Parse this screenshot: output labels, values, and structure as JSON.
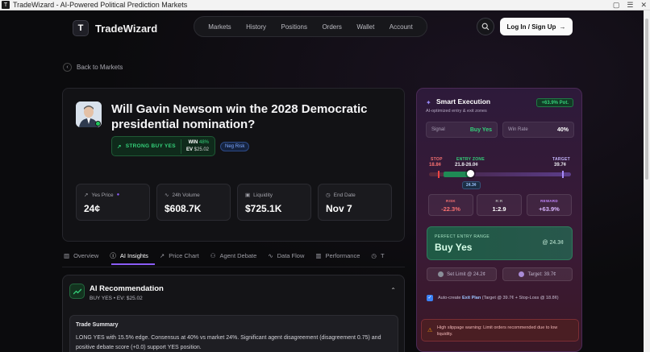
{
  "browser": {
    "title": "TradeWizard - AI-Powered Political Prediction Markets"
  },
  "brand": {
    "logo_letter": "T",
    "name": "TradeWizard"
  },
  "nav": {
    "items": [
      "Markets",
      "History",
      "Positions",
      "Orders",
      "Wallet",
      "Account"
    ]
  },
  "header": {
    "login_label": "Log In / Sign Up"
  },
  "back_label": "Back to Markets",
  "market": {
    "title": "Will Gavin Newsom win the 2028 Democratic presidential nomination?",
    "signal_label": "STRONG BUY YES",
    "win_label": "WIN",
    "win_value": "48%",
    "ev_label": "EV",
    "ev_value": "$25.02",
    "risk_badge": "Neg Risk",
    "stats": [
      {
        "label": "Yes Price",
        "value": "24¢"
      },
      {
        "label": "24h Volume",
        "value": "$608.7K"
      },
      {
        "label": "Liquidity",
        "value": "$725.1K"
      },
      {
        "label": "End Date",
        "value": "Nov 7"
      }
    ]
  },
  "tabs": [
    "Overview",
    "AI Insights",
    "Price Chart",
    "Agent Debate",
    "Data Flow",
    "Performance",
    "T"
  ],
  "recommendation": {
    "title": "AI Recommendation",
    "subtitle": "BUY YES • EV: $25.02",
    "summary_title": "Trade Summary",
    "summary_text": "LONG YES with 15.5% edge. Consensus at 40% vs market 24%. Significant agent disagreement (disagreement 0.75) and positive debate score (+0.0) support YES position."
  },
  "execution": {
    "title": "Smart Execution",
    "subtitle": "AI-optimized entry & exit zones",
    "profit_pill": "+63.9% Pot.",
    "signal_label": "Signal",
    "signal_value": "Buy Yes",
    "winrate_label": "Win Rate",
    "winrate_value": "40%",
    "stop_label": "STOP",
    "stop_value": "18.8¢",
    "entry_label": "ENTRY ZONE",
    "entry_value": "21.8-26.0¢",
    "target_label": "TARGET",
    "target_value": "39.7¢",
    "current_tag": "24.3¢",
    "risk_label": "RISK",
    "risk_value": "-22.3%",
    "rr_label": "R:R",
    "rr_value": "1:2.9",
    "reward_label": "REWARD",
    "reward_value": "+63.9%",
    "perfect_label": "PERFECT ENTRY RANGE",
    "perfect_value": "Buy Yes",
    "perfect_at": "@ 24.3¢",
    "set_limit": "Set Limit @ 24.2¢",
    "target_btn": "Target: 39.7¢",
    "auto_prefix": "Auto-create",
    "auto_exit": "Exit Plan",
    "auto_suffix": "(Target @ 39.7¢ + Stop-Loss @ 18.8¢)",
    "warning": "High slippage warning: Limit orders recommended due to low liquidity."
  },
  "colors": {
    "accent": "#8b5cf6",
    "buy": "#34d17a",
    "risk": "#ef4444",
    "reward": "#c084fc"
  }
}
